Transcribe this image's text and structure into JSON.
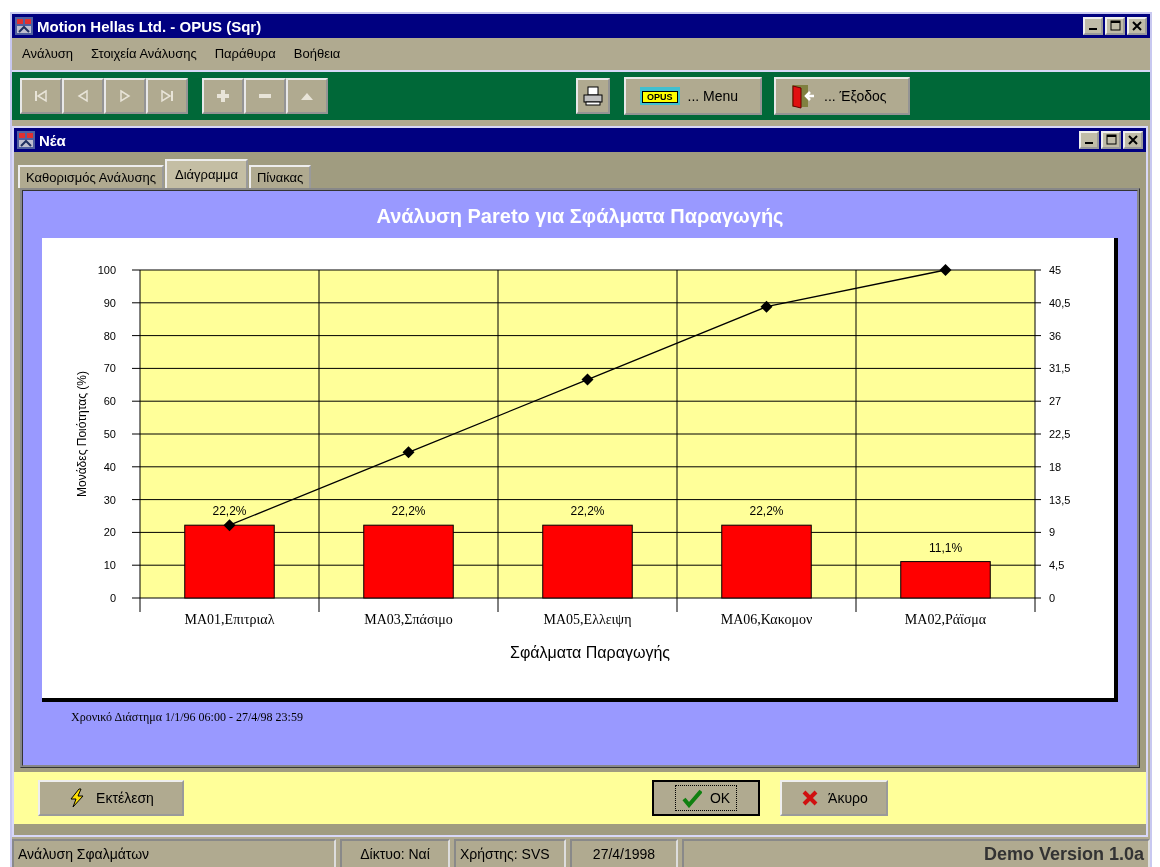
{
  "window": {
    "title": "Motion Hellas Ltd. - OPUS (Sqr)"
  },
  "menu": [
    "Ανάλυση",
    "Στοιχεία Ανάλυσης",
    "Παράθυρα",
    "Βοήθεια"
  ],
  "toolbar": {
    "nav_buttons": [
      {
        "kind": "first",
        "disabled": true
      },
      {
        "kind": "prev",
        "disabled": true
      },
      {
        "kind": "next",
        "disabled": true
      },
      {
        "kind": "last",
        "disabled": true
      },
      {
        "kind": "add",
        "disabled": true
      },
      {
        "kind": "remove",
        "disabled": true
      },
      {
        "kind": "edit",
        "disabled": true
      }
    ],
    "menu_button": {
      "badge": "OPUS",
      "label": "... Menu"
    },
    "exit_button": {
      "label": "... Έξοδος"
    }
  },
  "child_window": {
    "title": "Νέα",
    "tabs": [
      {
        "label": "Καθορισμός Ανάλυσης",
        "selected": false
      },
      {
        "label": "Διάγραμμα",
        "selected": true
      },
      {
        "label": "Πίνακας",
        "selected": false
      }
    ],
    "chart_panel": {
      "title": "Ανάλυση Pareto για Σφάλματα Παραγωγής",
      "chart_data": {
        "type": "bar",
        "xlabel": "Σφάλματα Παραγωγής",
        "ylabel": "Μονάδες Ποιότητας (%)",
        "categories": [
          "MA01,Επιτριαλ",
          "MA03,Σπάσιμο",
          "MA05,Ελλειψη",
          "MA06,Κακομον",
          "MA02,Ράϊσμα"
        ],
        "series": [
          {
            "type": "bar",
            "color": "#ff0000",
            "values": [
              22.2,
              22.2,
              22.2,
              22.2,
              11.1
            ]
          },
          {
            "type": "line",
            "color": "#000000",
            "marker": "diamond",
            "values": [
              22.2,
              44.4,
              66.6,
              88.8,
              100
            ]
          }
        ],
        "grid": true,
        "y2lim": [
          0,
          45
        ],
        "ylim": [
          0,
          100
        ],
        "yticks": [
          0,
          10,
          20,
          30,
          40,
          50,
          60,
          70,
          80,
          90,
          100
        ],
        "y2ticks": [
          {
            "value": 0,
            "label": "0"
          },
          {
            "value": 4.5,
            "label": "4,5"
          },
          9,
          {
            "value": 13.5,
            "label": "13,5"
          },
          {
            "value": 18,
            "label": "18"
          },
          {
            "value": 22.5,
            "label": "22,5"
          },
          {
            "value": 27,
            "label": "27"
          },
          {
            "value": 31.5,
            "label": "31,5"
          },
          {
            "value": 36,
            "label": "36"
          },
          {
            "value": 40.5,
            "label": "40,5"
          },
          {
            "value": 45,
            "label": "45"
          }
        ],
        "value_labels": [
          "22,2%",
          "22,2%",
          "22,2%",
          "22,2%",
          "11,1%"
        ]
      },
      "footer": "Χρονικό Διάστημα 1/1/96 06:00 - 27/4/98 23:59"
    },
    "buttons": [
      {
        "kind": "run",
        "label": "Εκτέλεση",
        "default": false
      },
      {
        "kind": "ok",
        "label": "OK",
        "default": true
      },
      {
        "kind": "cancel",
        "label": "Άκυρο",
        "default": false
      }
    ]
  },
  "status_bar": {
    "panels": [
      "Ανάλυση Σφαλμάτων",
      "Δίκτυο: Ναί",
      "Χρήστης: SVS",
      "27/4/1998"
    ],
    "version": "Demo Version 1.0a"
  }
}
